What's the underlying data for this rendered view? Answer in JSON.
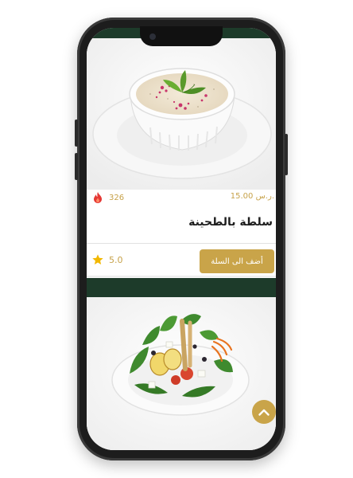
{
  "menu_item": {
    "title": "سلطة بالطحينة",
    "price": "15.00 ر.س.",
    "calories": "326",
    "rating": "5.0",
    "add_to_cart_label": "أضف الى السلة",
    "image_alt": "tahini salad bowl"
  },
  "next_item": {
    "image_alt": "green salad plate"
  },
  "icons": {
    "calories": "fire-icon",
    "rating": "star-icon",
    "scroll": "chevron-up-icon"
  },
  "colors": {
    "accent_gold": "#c9a449",
    "header_green": "#1d3b2a",
    "calorie_red": "#e53935"
  }
}
